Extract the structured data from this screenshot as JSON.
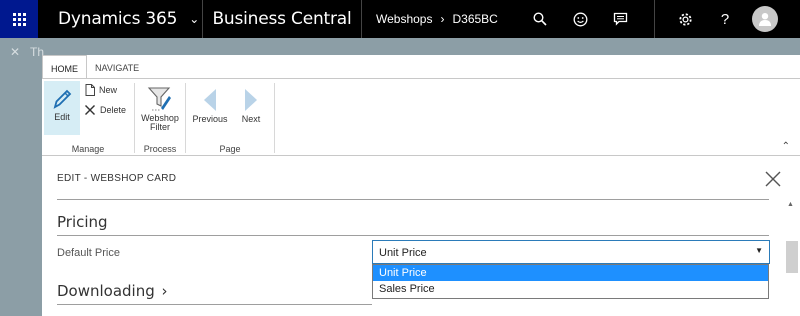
{
  "topbar": {
    "app_name": "Dynamics 365",
    "product": "Business Central",
    "breadcrumb": [
      "Webshops",
      "D365BC"
    ]
  },
  "background": {
    "tab_fragment": "Th"
  },
  "ribbon": {
    "tabs": [
      {
        "label": "HOME",
        "active": true
      },
      {
        "label": "NAVIGATE",
        "active": false
      }
    ],
    "groups": {
      "manage": {
        "label": "Manage",
        "edit_label": "Edit",
        "new_label": "New",
        "delete_label": "Delete"
      },
      "process": {
        "label": "Process",
        "webshop_filter_label_1": "Webshop",
        "webshop_filter_label_2": "Filter"
      },
      "page": {
        "label": "Page",
        "previous_label": "Previous",
        "next_label": "Next"
      }
    }
  },
  "card": {
    "title": "EDIT - WEBSHOP CARD",
    "sections": {
      "pricing": "Pricing",
      "downloading": "Downloading"
    },
    "fields": {
      "default_price": {
        "label": "Default Price",
        "value": "Unit Price",
        "options": [
          "Unit Price",
          "Sales Price"
        ]
      }
    }
  },
  "colors": {
    "topbar_bg": "#000000",
    "waffle_bg": "#00188f",
    "accent": "#2b7bb9",
    "selected_option": "#1e90ff",
    "edit_button_bg": "#d6edf5"
  }
}
